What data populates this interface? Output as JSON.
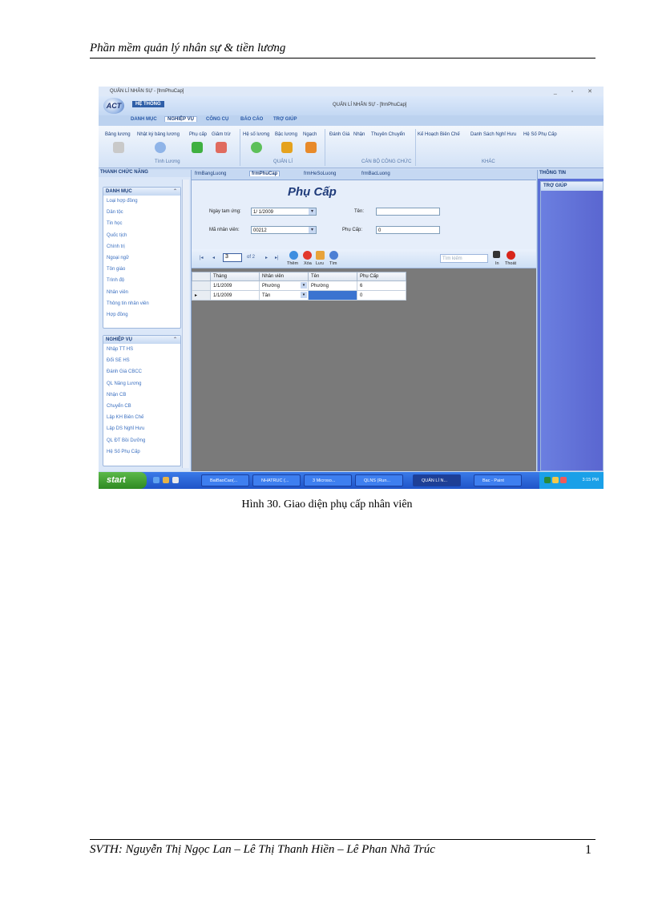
{
  "document": {
    "header": "Phần mềm quản lý nhân sự & tiền lương",
    "caption": "Hình 30. Giao diện phụ cấp nhân viên",
    "footer": "SVTH: Nguyễn Thị Ngọc Lan – Lê Thị Thanh Hiền – Lê Phan Nhã Trúc",
    "page_number": "1"
  },
  "app": {
    "window_title": "QUẢN LÍ NHÂN SỰ - [frmPhuCap]",
    "center_title": "QUẢN LÍ NHÂN SỰ - [frmPhuCap]",
    "home_button": "HỆ THỐNG",
    "logo_text": "ACT",
    "tabs": [
      "DANH MỤC",
      "NGHIỆP VỤ",
      "CÔNG CỤ",
      "BÁO CÁO",
      "TRỢ GIÚP"
    ],
    "active_tab": "NGHIỆP VỤ",
    "ribbon": {
      "buttons": [
        "Bảng lương",
        "Nhật ký bảng lương",
        "Phụ cấp",
        "Giảm trừ",
        "Hệ số lương",
        "Bậc lương",
        "Ngạch",
        "Đánh Giá",
        "Nhận",
        "Thuyên Chuyển",
        "Kế Hoạch Biên Chế",
        "Danh Sách Nghỉ Hưu",
        "Hệ Số Phụ Cấp"
      ],
      "groups": [
        "Tính Lương",
        "QUẢN LÍ",
        "CÁN BỘ CÔNG CHỨC",
        "KHÁC"
      ]
    },
    "left_pane": {
      "title": "THANH CHỨC NĂNG",
      "sections": [
        {
          "title": "DANH MỤC",
          "items": [
            "Loại hợp đồng",
            "Dân tộc",
            "Tin học",
            "Quốc tịch",
            "Chính trị",
            "Ngoại ngữ",
            "Tôn giáo",
            "Trình độ",
            "Nhân viên",
            "Thông tin nhân viên",
            "Hợp đồng"
          ]
        },
        {
          "title": "NGHIỆP VỤ",
          "items": [
            "Nhập TT HS",
            "Đổi SE HS",
            "Đánh Giá CBCC",
            "QL Nâng Lương",
            "Nhận CB",
            "Chuyển CB",
            "Lập KH Biên Chế",
            "Lập DS Nghỉ Hưu",
            "QL ĐT Bồi Dưỡng",
            "Hệ Số Phụ Cấp"
          ]
        }
      ]
    },
    "doc_tabs": [
      "frmBangLuong",
      "frmPhuCap",
      "frmHeSoLuong",
      "frmBacLuong"
    ],
    "active_doc_tab": "frmPhuCap",
    "form": {
      "title": "Phụ Cấp",
      "fields": {
        "ngay_label": "Ngày tam ứng:",
        "ngay_value": "1/ 1/2009",
        "ten_label": "Tên:",
        "ten_value": "",
        "manv_label": "Mã nhân viên:",
        "manv_value": "00212",
        "phucap_label": "Phụ Cấp:",
        "phucap_value": "0"
      }
    },
    "navigator": {
      "position": "3",
      "of_text": "of 2",
      "buttons": [
        "Thêm",
        "Xóa",
        "Lưu",
        "Tìm",
        "In",
        "Thoát"
      ],
      "search_placeholder": "Tìm kiếm"
    },
    "grid": {
      "columns": [
        "Tháng",
        "Nhân viên",
        "Tên",
        "Phụ Cấp"
      ],
      "rows": [
        [
          "1/1/2009",
          "Phường",
          "Phường",
          "6"
        ],
        [
          "1/1/2009",
          "Tân",
          "",
          "0"
        ]
      ]
    },
    "right_pane": {
      "title": "THÔNG TIN",
      "section": "TRỢ GIÚP"
    },
    "taskbar": {
      "start": "start",
      "tasks": [
        "BaiBaoCao(...",
        "NHATRUC (...",
        "3 Microso...",
        "QLNS (Run...",
        "QUẢN LÍ N...",
        "Bac - Paint"
      ],
      "active_task": "QUẢN LÍ N...",
      "clock": "3:15 PM"
    },
    "colors": {
      "ribbon_blue": "#c4d8f3",
      "right_pane_blue": "#5a6fd6",
      "grid_background": "#7a7a7a",
      "taskbar_blue": "#1f54c8",
      "start_green": "#2e8a22"
    }
  }
}
